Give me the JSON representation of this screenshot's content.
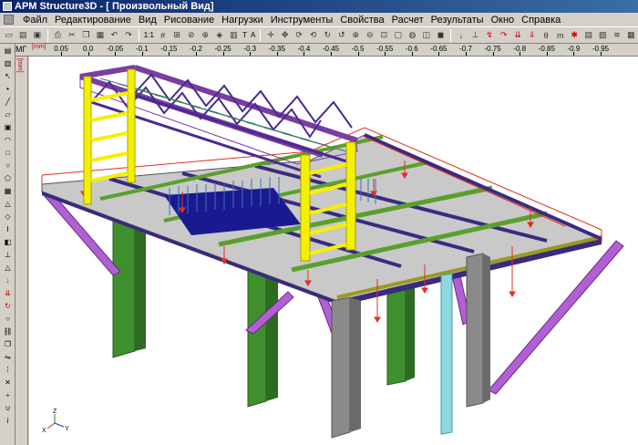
{
  "window": {
    "title": "APM Structure3D - [ Произвольный Вид]"
  },
  "menu": {
    "items": [
      "Файл",
      "Редактирование",
      "Вид",
      "Рисование",
      "Нагрузки",
      "Инструменты",
      "Свойства",
      "Расчет",
      "Результаты",
      "Окно",
      "Справка"
    ]
  },
  "toolbar": {
    "zoom_label": "1:1",
    "text_a": "T",
    "text_b": "A"
  },
  "ruler": {
    "label": "МГ",
    "unit": "[mm]",
    "ticks": [
      "0.05",
      "0.0",
      "-0.05",
      "-0.1",
      "-0.15",
      "-0.2",
      "-0.25",
      "-0.3",
      "-0.35",
      "-0.4",
      "-0.45",
      "-0.5",
      "-0.55",
      "-0.6",
      "-0.65",
      "-0.7",
      "-0.75",
      "-0.8",
      "-0.85",
      "-0.9",
      "-0.95"
    ]
  },
  "vruler": {
    "unit": "[mm]"
  },
  "axes": {
    "z": "Z",
    "x": "X",
    "y": "Y"
  },
  "colors": {
    "accent": "#0a246a",
    "beam_purple": "#7a3da0",
    "beam_green": "#5aa02c",
    "column_green": "#3f8f2f",
    "column_gray": "#8a8a8a",
    "column_cyan": "#8ed8e0",
    "frame_yellow": "#f5f000",
    "deck_gray": "#c9c9c9",
    "load_red": "#e03020"
  }
}
